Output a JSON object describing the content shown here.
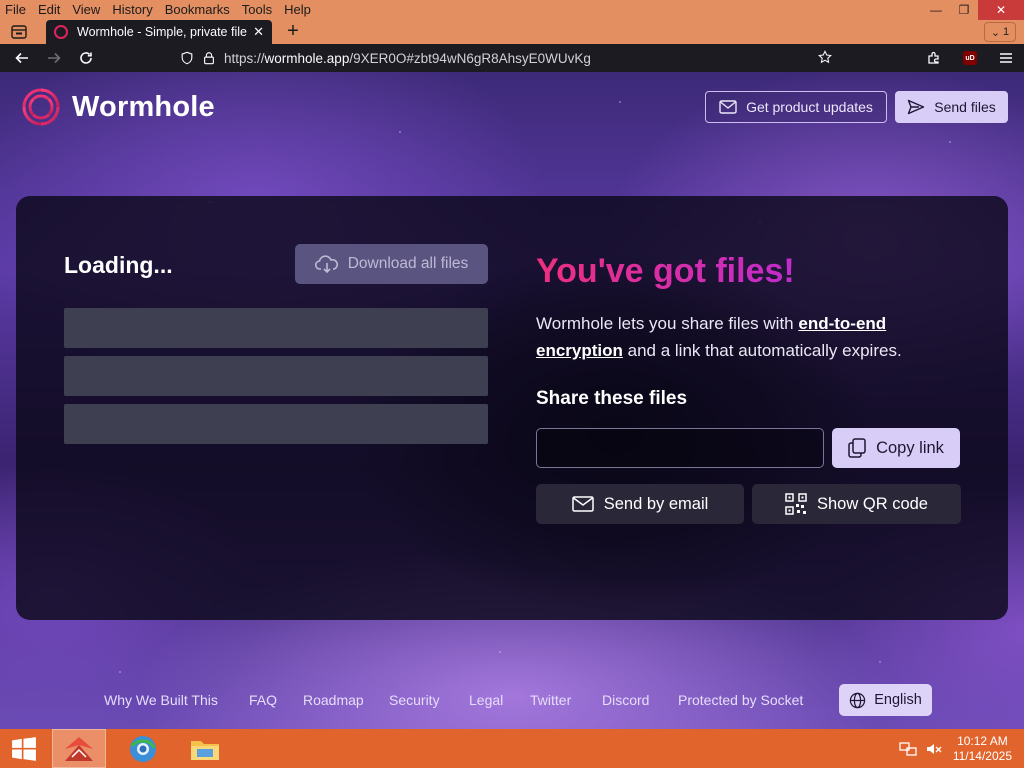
{
  "browser": {
    "menu": [
      "File",
      "Edit",
      "View",
      "History",
      "Bookmarks",
      "Tools",
      "Help"
    ],
    "tab_title": "Wormhole - Simple, private file",
    "tab_overflow_count": "1",
    "url_scheme": "https://",
    "url_host": "wormhole.app",
    "url_path": "/9XER0O#zbt94wN6gR8AhsyE0WUvKg"
  },
  "header": {
    "logo_text": "Wormhole",
    "updates_label": "Get product updates",
    "send_label": "Send files"
  },
  "left_panel": {
    "status": "Loading...",
    "download_label": "Download all files",
    "skeleton_rows": 3
  },
  "right_panel": {
    "title": "You've got files!",
    "desc_prefix": "Wormhole lets you share files with ",
    "desc_link": "end-to-end encryption",
    "desc_suffix": " and a link that automatically expires.",
    "share_heading": "Share these files",
    "share_value": "",
    "copy_label": "Copy link",
    "email_label": "Send by email",
    "qr_label": "Show QR code"
  },
  "footer": {
    "links": [
      "Why We Built This",
      "FAQ",
      "Roadmap",
      "Security",
      "Legal",
      "Twitter",
      "Discord",
      "Protected by Socket"
    ],
    "language": "English"
  },
  "taskbar": {
    "time": "10:12 AM",
    "date": "11/14/2025"
  },
  "colors": {
    "accent_pink": "#ee2f7e",
    "accent_purple": "#c12ccd",
    "button_lavender": "#d8cdf7",
    "taskbar": "#e2642d",
    "titlebar": "#e48f62"
  },
  "icons": [
    "tab-list-icon",
    "back-arrow-icon",
    "forward-arrow-icon",
    "reload-icon",
    "shield-icon",
    "lock-icon",
    "star-icon",
    "extensions-icon",
    "ublock-icon",
    "hamburger-icon",
    "wormhole-logo-icon",
    "mail-icon",
    "send-icon",
    "cloud-download-icon",
    "copy-icon",
    "qr-code-icon",
    "globe-icon",
    "windows-start-icon"
  ]
}
